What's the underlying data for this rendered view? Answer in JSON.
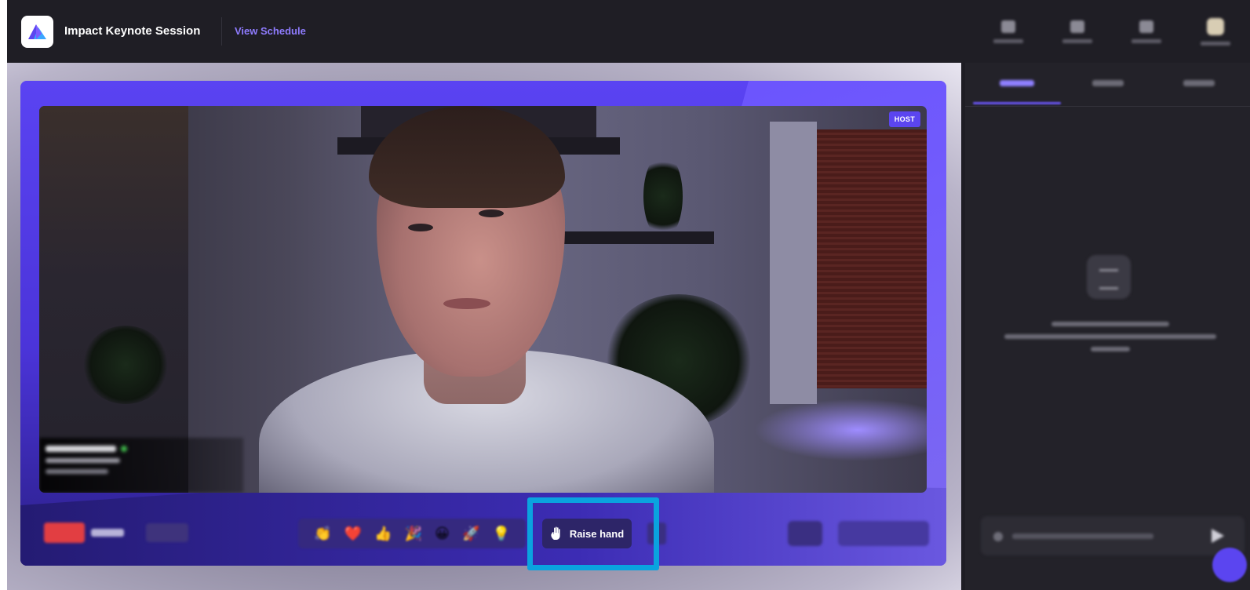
{
  "header": {
    "session_title": "Impact Keynote Session",
    "schedule_link": "View Schedule",
    "nav_icons": [
      "people-icon",
      "backstage-icon",
      "booth-icon",
      "profile-avatar"
    ]
  },
  "stage": {
    "host_badge": "HOST",
    "controls": {
      "reactions": [
        "👏",
        "❤️",
        "👍",
        "🎉",
        "😀",
        "🚀",
        "💡"
      ],
      "raise_hand_label": "Raise hand"
    }
  },
  "colors": {
    "accent": "#5b45f0",
    "highlight": "#0aa3df",
    "live": "#e23e42",
    "background": "#1e1d24"
  }
}
